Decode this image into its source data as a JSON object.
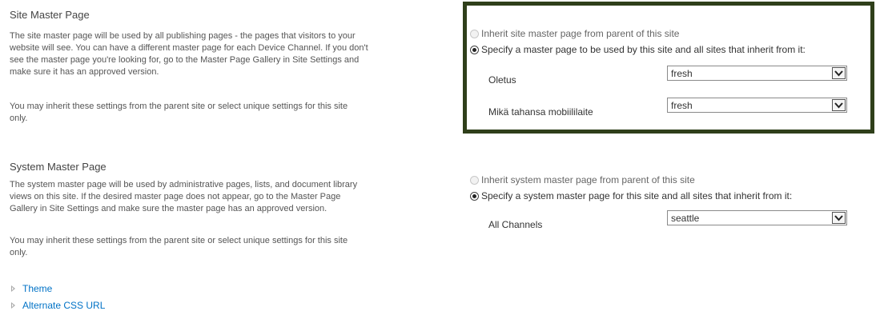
{
  "site_master": {
    "title": "Site Master Page",
    "description": [
      "The site master page will be used by all publishing pages - the pages that visitors to your",
      "website will see. You can have a different master page for each Device Channel. If you don't",
      "see the master page you're looking for, go to the Master Page Gallery in Site Settings and",
      "make sure it has an approved version."
    ],
    "inherit_note": [
      "You may inherit these settings from the parent site or select unique settings for this site",
      "only."
    ],
    "option_inherit": "Inherit site master page from parent of this site",
    "option_specify": "Specify a master page to be used by this site and all sites that inherit from it:",
    "channels": [
      {
        "label": "Oletus",
        "value": "fresh"
      },
      {
        "label": "Mikä tahansa mobiililaite",
        "value": "fresh"
      }
    ]
  },
  "system_master": {
    "title": "System Master Page",
    "description": [
      "The system master page will be used by administrative pages, lists, and document library",
      "views on this site. If the desired master page does not appear, go to the Master Page",
      "Gallery in Site Settings and make sure the master page has an approved version."
    ],
    "inherit_note": [
      "You may inherit these settings from the parent site or select unique settings for this site",
      "only."
    ],
    "option_inherit": "Inherit system master page from parent of this site",
    "option_specify": "Specify a system master page for this site and all sites that inherit from it:",
    "channels": [
      {
        "label": "All Channels",
        "value": "seattle"
      }
    ]
  },
  "links": {
    "theme": "Theme",
    "alternate_css": "Alternate CSS URL"
  },
  "colors": {
    "link": "#0072c6",
    "highlight_border": "#2f3f1a"
  }
}
